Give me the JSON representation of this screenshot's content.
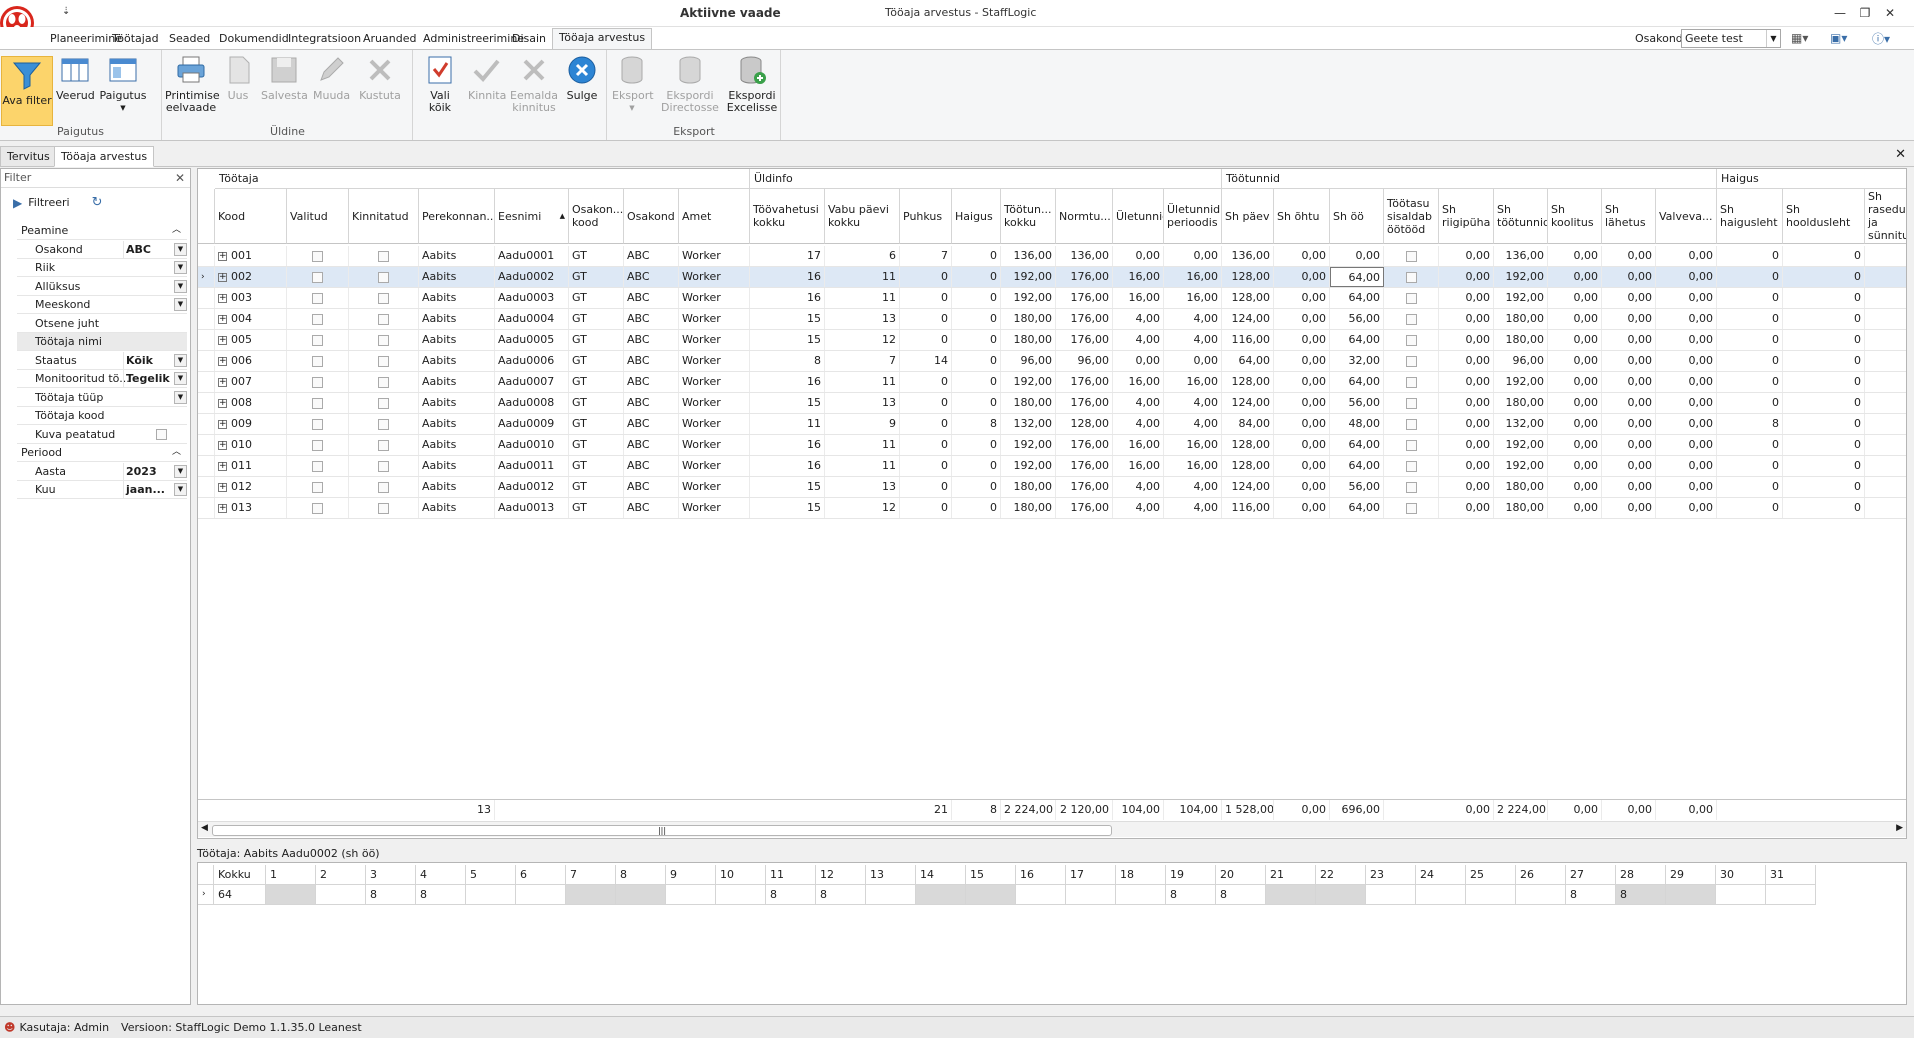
{
  "window": {
    "title_context": "Aktiivne vaade",
    "title": "Tööaja arvestus - StaffLogic",
    "qat_symbol": "⇣"
  },
  "ribbon_tabs": [
    "Planeerimine",
    "Töötajad",
    "Seaded",
    "Dokumendid",
    "Integratsioon",
    "Aruanded",
    "Administreerimine",
    "Disain",
    "Tööaja arvestus"
  ],
  "header": {
    "osakond_label": "Osakond",
    "osakond_value": "Geete test"
  },
  "ribbon": {
    "groups": [
      {
        "label": "Paigutus",
        "buttons": [
          {
            "label": "Ava filter",
            "icon": "funnel-icon",
            "state": "pressed"
          },
          {
            "label": "Veerud",
            "icon": "columns-icon",
            "state": "normal"
          },
          {
            "label": "Paigutus",
            "icon": "layout-icon",
            "state": "normal"
          }
        ]
      },
      {
        "label": "Üldine",
        "buttons": [
          {
            "label": "Printimise eelvaade",
            "icon": "printer-icon",
            "state": "normal"
          },
          {
            "label": "Uus",
            "icon": "new-doc-icon",
            "state": "disabled"
          },
          {
            "label": "Salvesta",
            "icon": "save-icon",
            "state": "disabled"
          },
          {
            "label": "Muuda",
            "icon": "pencil-icon",
            "state": "disabled"
          },
          {
            "label": "Kustuta",
            "icon": "delete-x-icon",
            "state": "disabled"
          }
        ]
      },
      {
        "label": "",
        "buttons": [
          {
            "label": "Vali kõik",
            "icon": "select-all-icon",
            "state": "normal"
          },
          {
            "label": "Kinnita",
            "icon": "check-icon",
            "state": "disabled"
          },
          {
            "label": "Eemalda kinnitus",
            "icon": "remove-x-icon",
            "state": "disabled"
          },
          {
            "label": "Sulge",
            "icon": "close-circle-icon",
            "state": "normal"
          }
        ]
      },
      {
        "label": "Eksport",
        "buttons": [
          {
            "label": "Eksport",
            "icon": "export-db-icon",
            "state": "disabled"
          },
          {
            "label": "Ekspordi Directosse",
            "icon": "export-directo-icon",
            "state": "disabled"
          },
          {
            "label": "Ekspordi Excelisse",
            "icon": "export-excel-icon",
            "state": "normal"
          }
        ]
      }
    ]
  },
  "doc_tabs": [
    "Tervitus",
    "Tööaja arvestus"
  ],
  "filter": {
    "title": "Filter",
    "run_label": "Filtreeri",
    "categories": [
      {
        "name": "Peamine",
        "fields": [
          {
            "label": "Osakond",
            "value": "ABC",
            "dropdown": true
          },
          {
            "label": "Riik",
            "value": "",
            "dropdown": true
          },
          {
            "label": "Allüksus",
            "value": "",
            "dropdown": true
          },
          {
            "label": "Meeskond",
            "value": "",
            "dropdown": true
          },
          {
            "label": "Otsene juht",
            "value": "",
            "dropdown": false
          },
          {
            "label": "Töötaja nimi",
            "value": "",
            "dropdown": false
          },
          {
            "label": "Staatus",
            "value": "Kõik",
            "dropdown": true
          },
          {
            "label": "Monitooritud tö...",
            "value": "Tegelik",
            "dropdown": true
          },
          {
            "label": "Töötaja tüüp",
            "value": "",
            "dropdown": true
          },
          {
            "label": "Töötaja kood",
            "value": "",
            "dropdown": false
          },
          {
            "label": "Kuva peatatud",
            "value": "",
            "dropdown": false,
            "checkbox": true
          }
        ]
      },
      {
        "name": "Periood",
        "fields": [
          {
            "label": "Aasta",
            "value": "2023",
            "dropdown": true
          },
          {
            "label": "Kuu",
            "value": "jaan...",
            "dropdown": true
          }
        ]
      }
    ]
  },
  "grid": {
    "bands": [
      {
        "label": "Töötaja"
      },
      {
        "label": "Üldinfo"
      },
      {
        "label": "Töötunnid"
      },
      {
        "label": "Haigus"
      }
    ],
    "columns": [
      "Kood",
      "Valitud",
      "Kinnitatud",
      "Perekonnan...",
      "Eesnimi",
      "Osakon... kood",
      "Osakond",
      "Amet",
      "Töövahetusi kokku",
      "Vabu päevi kokku",
      "Puhkus",
      "Haigus",
      "Töötun... kokku",
      "Normtu...",
      "Ületunnid",
      "Ületunnid perioodis",
      "Sh päev",
      "Sh õhtu",
      "Sh öö",
      "Töötasu sisaldab öötööd",
      "Sh riigipüha",
      "Sh töötunnid",
      "Sh koolitus",
      "Sh lähetus",
      "Valveva...",
      "Sh haigusleht",
      "Sh hooldusleht",
      "Sh rasedus ja sünnitus"
    ],
    "rows": [
      [
        "001",
        "Aabits",
        "Aadu0001",
        "GT",
        "ABC",
        "Worker",
        "17",
        "6",
        "7",
        "0",
        "136,00",
        "136,00",
        "0,00",
        "0,00",
        "136,00",
        "0,00",
        "0,00",
        "0,00",
        "136,00",
        "0,00",
        "0,00",
        "0,00",
        "0",
        "0"
      ],
      [
        "002",
        "Aabits",
        "Aadu0002",
        "GT",
        "ABC",
        "Worker",
        "16",
        "11",
        "0",
        "0",
        "192,00",
        "176,00",
        "16,00",
        "16,00",
        "128,00",
        "0,00",
        "64,00",
        "0,00",
        "192,00",
        "0,00",
        "0,00",
        "0,00",
        "0",
        "0"
      ],
      [
        "003",
        "Aabits",
        "Aadu0003",
        "GT",
        "ABC",
        "Worker",
        "16",
        "11",
        "0",
        "0",
        "192,00",
        "176,00",
        "16,00",
        "16,00",
        "128,00",
        "0,00",
        "64,00",
        "0,00",
        "192,00",
        "0,00",
        "0,00",
        "0,00",
        "0",
        "0"
      ],
      [
        "004",
        "Aabits",
        "Aadu0004",
        "GT",
        "ABC",
        "Worker",
        "15",
        "13",
        "0",
        "0",
        "180,00",
        "176,00",
        "4,00",
        "4,00",
        "124,00",
        "0,00",
        "56,00",
        "0,00",
        "180,00",
        "0,00",
        "0,00",
        "0,00",
        "0",
        "0"
      ],
      [
        "005",
        "Aabits",
        "Aadu0005",
        "GT",
        "ABC",
        "Worker",
        "15",
        "12",
        "0",
        "0",
        "180,00",
        "176,00",
        "4,00",
        "4,00",
        "116,00",
        "0,00",
        "64,00",
        "0,00",
        "180,00",
        "0,00",
        "0,00",
        "0,00",
        "0",
        "0"
      ],
      [
        "006",
        "Aabits",
        "Aadu0006",
        "GT",
        "ABC",
        "Worker",
        "8",
        "7",
        "14",
        "0",
        "96,00",
        "96,00",
        "0,00",
        "0,00",
        "64,00",
        "0,00",
        "32,00",
        "0,00",
        "96,00",
        "0,00",
        "0,00",
        "0,00",
        "0",
        "0"
      ],
      [
        "007",
        "Aabits",
        "Aadu0007",
        "GT",
        "ABC",
        "Worker",
        "16",
        "11",
        "0",
        "0",
        "192,00",
        "176,00",
        "16,00",
        "16,00",
        "128,00",
        "0,00",
        "64,00",
        "0,00",
        "192,00",
        "0,00",
        "0,00",
        "0,00",
        "0",
        "0"
      ],
      [
        "008",
        "Aabits",
        "Aadu0008",
        "GT",
        "ABC",
        "Worker",
        "15",
        "13",
        "0",
        "0",
        "180,00",
        "176,00",
        "4,00",
        "4,00",
        "124,00",
        "0,00",
        "56,00",
        "0,00",
        "180,00",
        "0,00",
        "0,00",
        "0,00",
        "0",
        "0"
      ],
      [
        "009",
        "Aabits",
        "Aadu0009",
        "GT",
        "ABC",
        "Worker",
        "11",
        "9",
        "0",
        "8",
        "132,00",
        "128,00",
        "4,00",
        "4,00",
        "84,00",
        "0,00",
        "48,00",
        "0,00",
        "132,00",
        "0,00",
        "0,00",
        "0,00",
        "8",
        "0"
      ],
      [
        "010",
        "Aabits",
        "Aadu0010",
        "GT",
        "ABC",
        "Worker",
        "16",
        "11",
        "0",
        "0",
        "192,00",
        "176,00",
        "16,00",
        "16,00",
        "128,00",
        "0,00",
        "64,00",
        "0,00",
        "192,00",
        "0,00",
        "0,00",
        "0,00",
        "0",
        "0"
      ],
      [
        "011",
        "Aabits",
        "Aadu0011",
        "GT",
        "ABC",
        "Worker",
        "16",
        "11",
        "0",
        "0",
        "192,00",
        "176,00",
        "16,00",
        "16,00",
        "128,00",
        "0,00",
        "64,00",
        "0,00",
        "192,00",
        "0,00",
        "0,00",
        "0,00",
        "0",
        "0"
      ],
      [
        "012",
        "Aabits",
        "Aadu0012",
        "GT",
        "ABC",
        "Worker",
        "15",
        "13",
        "0",
        "0",
        "180,00",
        "176,00",
        "4,00",
        "4,00",
        "124,00",
        "0,00",
        "56,00",
        "0,00",
        "180,00",
        "0,00",
        "0,00",
        "0,00",
        "0",
        "0"
      ],
      [
        "013",
        "Aabits",
        "Aadu0013",
        "GT",
        "ABC",
        "Worker",
        "15",
        "12",
        "0",
        "0",
        "180,00",
        "176,00",
        "4,00",
        "4,00",
        "116,00",
        "0,00",
        "64,00",
        "0,00",
        "180,00",
        "0,00",
        "0,00",
        "0,00",
        "0",
        "0"
      ]
    ],
    "focused_row": 1,
    "totals": {
      "Perekonnan...": "13",
      "Puhkus": "21",
      "Haigus": "8",
      "Töötun... kokku": "2 224,00",
      "Normtu...": "2 120,00",
      "Ületunnid": "104,00",
      "Ületunnid perioodis": "104,00",
      "Sh päev": "1 528,00",
      "Sh õhtu": "0,00",
      "Sh öö": "696,00",
      "Sh riigipüha": "0,00",
      "Sh töötunnid": "2 224,00",
      "Sh koolitus": "0,00",
      "Sh lähetus": "0,00",
      "Valveva...": "0,00"
    }
  },
  "detail": {
    "label": "Töötaja: Aabits Aadu0002 (sh öö)",
    "total_header": "Kokku",
    "total": "64",
    "days": [
      "1",
      "2",
      "3",
      "4",
      "5",
      "6",
      "7",
      "8",
      "9",
      "10",
      "11",
      "12",
      "13",
      "14",
      "15",
      "16",
      "17",
      "18",
      "19",
      "20",
      "21",
      "22",
      "23",
      "24",
      "25",
      "26",
      "27",
      "28",
      "29",
      "30",
      "31"
    ],
    "values": [
      "",
      "",
      "8",
      "8",
      "",
      "",
      "",
      "",
      "",
      "",
      "8",
      "8",
      "",
      "",
      "",
      "",
      "",
      "",
      "8",
      "8",
      "",
      "",
      "",
      "",
      "",
      "",
      "8",
      "8",
      "",
      "",
      ""
    ],
    "weekend_days": [
      "1",
      "7",
      "8",
      "14",
      "15",
      "21",
      "22",
      "28",
      "29"
    ]
  },
  "status": {
    "user_label": "Kasutaja: Admin",
    "version_label": "Versioon: StaffLogic Demo 1.1.35.0 Leanest"
  },
  "colors": {
    "accent": "#fcd46b",
    "focus_row": "#dde8f5",
    "logo_red": "#d9261c"
  }
}
